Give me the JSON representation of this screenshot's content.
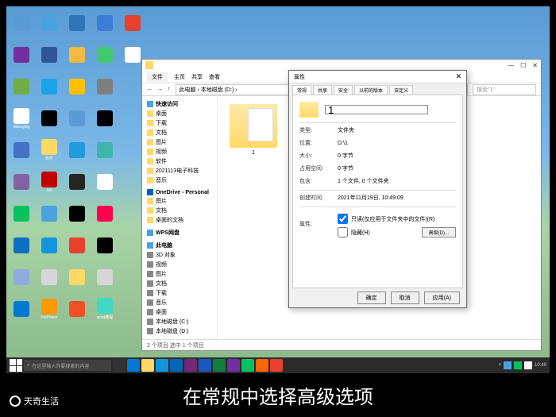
{
  "desktop": {
    "icons": [
      {
        "color": "#5b9bd5",
        "label": ""
      },
      {
        "color": "#4aa3df",
        "label": ""
      },
      {
        "color": "#2e75b6",
        "label": ""
      },
      {
        "color": "#3c7dd9",
        "label": ""
      },
      {
        "color": "#e8412c",
        "label": ""
      },
      {
        "color": "#7030a0",
        "label": ""
      },
      {
        "color": "#2f5597",
        "label": ""
      },
      {
        "color": "#f4b942",
        "label": ""
      },
      {
        "color": "#41c971",
        "label": ""
      },
      {
        "color": "#ffffff",
        "label": ""
      },
      {
        "color": "#70ad47",
        "label": ""
      },
      {
        "color": "#1aa3e8",
        "label": ""
      },
      {
        "color": "#ffc000",
        "label": ""
      },
      {
        "color": "#7f7f7f",
        "label": ""
      },
      {
        "color": "",
        "label": ""
      },
      {
        "color": "#ffffff",
        "label": "debuglog"
      },
      {
        "color": "#000",
        "label": ""
      },
      {
        "color": "#5b9bd5",
        "label": ""
      },
      {
        "color": "#000",
        "label": ""
      },
      {
        "color": "",
        "label": ""
      },
      {
        "color": "#4472c4",
        "label": ""
      },
      {
        "color": "#ffd966",
        "label": "软件"
      },
      {
        "color": "#1f9bde",
        "label": ""
      },
      {
        "color": "#3fb4aa",
        "label": ""
      },
      {
        "color": "",
        "label": ""
      },
      {
        "color": "#8064a2",
        "label": ""
      },
      {
        "color": "#c00000",
        "label": "wit"
      },
      {
        "color": "#262626",
        "label": ""
      },
      {
        "color": "#ffffff",
        "label": ""
      },
      {
        "color": "",
        "label": ""
      },
      {
        "color": "#07c160",
        "label": ""
      },
      {
        "color": "#4aa3df",
        "label": ""
      },
      {
        "color": "#000",
        "label": ""
      },
      {
        "color": "#ff0050",
        "label": ""
      },
      {
        "color": "",
        "label": ""
      },
      {
        "color": "#0d6fbf",
        "label": ""
      },
      {
        "color": "#1296db",
        "label": ""
      },
      {
        "color": "#e8412c",
        "label": ""
      },
      {
        "color": "#000",
        "label": ""
      },
      {
        "color": "",
        "label": ""
      },
      {
        "color": "#8faadc",
        "label": ""
      },
      {
        "color": "#d7d7d7",
        "label": ""
      },
      {
        "color": "#ffd966",
        "label": ""
      },
      {
        "color": "#d7d7d7",
        "label": ""
      },
      {
        "color": "",
        "label": ""
      },
      {
        "color": "#0078d4",
        "label": ""
      },
      {
        "color": "#ff9900",
        "label": "PotPlayer"
      },
      {
        "color": "#f25022",
        "label": ""
      },
      {
        "color": "#41d9c4",
        "label": "word教程"
      },
      {
        "color": "",
        "label": ""
      }
    ]
  },
  "explorer": {
    "title": "",
    "ribbon": {
      "tab_file": "文件",
      "tab_home": "主页",
      "tab_share": "共享",
      "tab_view": "查看"
    },
    "breadcrumb": {
      "path": "此电脑 › 本地磁盘 (D:) ›",
      "search_placeholder": "搜索\"1\""
    },
    "sidebar": {
      "quick": "快速访问",
      "items": [
        "桌面",
        "下载",
        "文档",
        "图片",
        "视频",
        "软件",
        "2021113电子科技",
        "音乐"
      ],
      "onedrive": "OneDrive - Personal",
      "od_items": [
        "图片",
        "文档",
        "桌面的文档"
      ],
      "wps": "WPS网盘",
      "thispc": "此电脑",
      "pc_items": [
        "3D 对象",
        "视频",
        "图片",
        "文档",
        "下载",
        "音乐",
        "桌面",
        "本地磁盘 (C:)",
        "本地磁盘 (D:)"
      ]
    },
    "folder_name": "1",
    "status": "2 个项目    选中 1 个项目"
  },
  "dialog": {
    "title": "属性",
    "tabs": [
      "常规",
      "共享",
      "安全",
      "以前的版本",
      "自定义"
    ],
    "name_value": "1",
    "rows": {
      "type_label": "类型:",
      "type_val": "文件夹",
      "loc_label": "位置:",
      "loc_val": "D:\\1",
      "size_label": "大小:",
      "size_val": "0 字节",
      "ondisk_label": "占用空间:",
      "ondisk_val": "0 字节",
      "contains_label": "包含:",
      "contains_val": "1 个文件, 0 个文件夹",
      "created_label": "创建时间:",
      "created_val": "2021年11月19日, 10:49:09",
      "attr_label": "属性:",
      "attr_readonly": "只读(仅应用于文件夹中的文件)(R)",
      "attr_hidden": "隐藏(H)"
    },
    "advanced_btn": "高级(D)...",
    "ok": "确定",
    "cancel": "取消",
    "apply": "应用(A)"
  },
  "taskbar": {
    "search_placeholder": "在这里输入你要搜索的内容",
    "apps": [
      {
        "color": "#333"
      },
      {
        "color": "#0078d4"
      },
      {
        "color": "#ffd966"
      },
      {
        "color": "#1296db"
      },
      {
        "color": "#0364b8"
      },
      {
        "color": "#742774"
      },
      {
        "color": "#185abd"
      },
      {
        "color": "#107c41"
      },
      {
        "color": "#7030a0"
      },
      {
        "color": "#07c160"
      },
      {
        "color": "#f60"
      },
      {
        "color": "#e8412c"
      }
    ],
    "time": "10:49"
  },
  "overlay": {
    "watermark": "天奇生活",
    "subtitle": "在常规中选择高级选项"
  }
}
